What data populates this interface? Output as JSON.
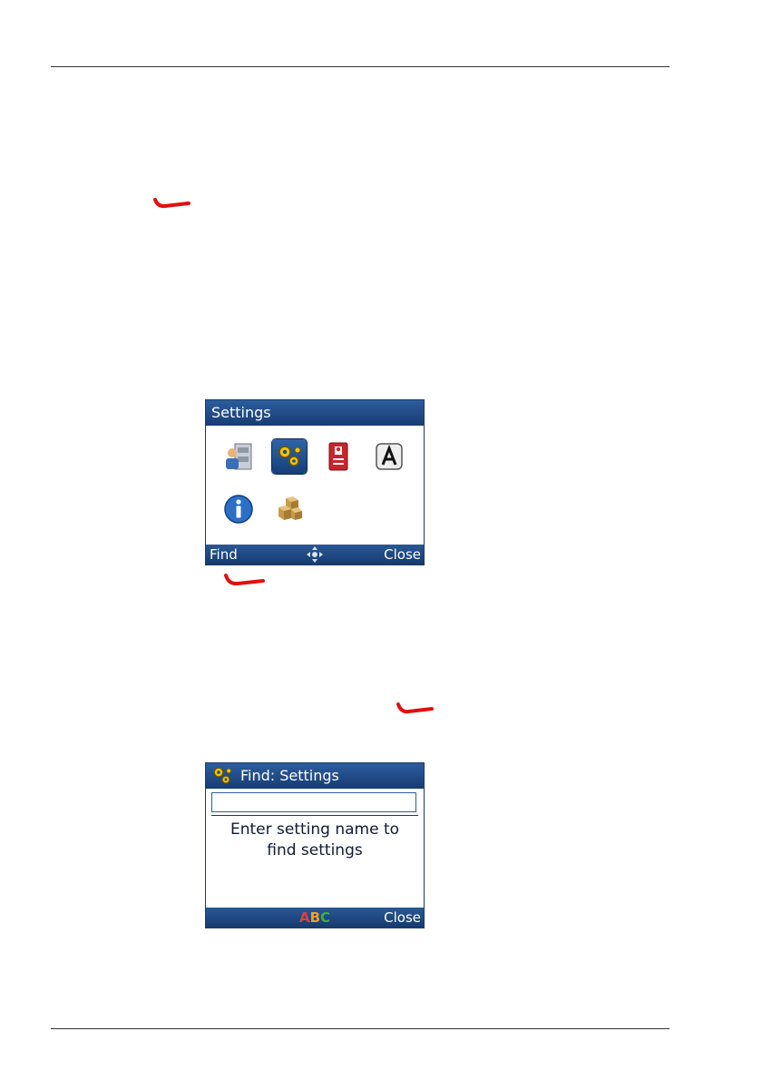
{
  "settings_screen": {
    "title": "Settings",
    "softkeys": {
      "left": "Find",
      "right": "Close"
    },
    "icons": [
      "user-records-icon",
      "gears-icon",
      "contact-card-icon",
      "font-a-icon",
      "info-icon",
      "packages-icon"
    ],
    "selected_icon": "gears-icon"
  },
  "find_screen": {
    "title": "Find: Settings",
    "search_value": "",
    "hint_line1": "Enter setting name to",
    "hint_line2": "find settings",
    "softkeys": {
      "center": "ABC",
      "right": "Close"
    }
  },
  "colors": {
    "titlebar": "#173c73",
    "softbar": "#163a70",
    "end_key_red": "#e01010",
    "abc_a": "#e0403a",
    "abc_b": "#f0a020",
    "abc_c": "#40b040"
  }
}
